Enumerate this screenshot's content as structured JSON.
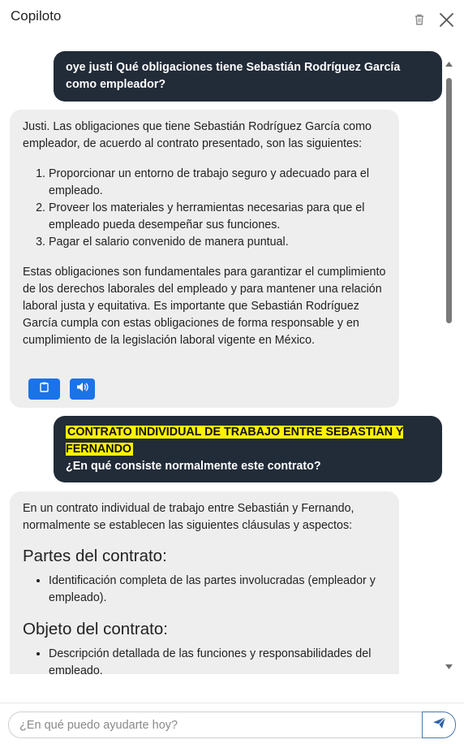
{
  "header": {
    "title": "Copiloto",
    "trash_icon": "trash-icon",
    "close_icon": "close-icon"
  },
  "messages": [
    {
      "role": "user",
      "text": "oye justi Qué obligaciones tiene Sebastián Rodríguez García como empleador?"
    },
    {
      "role": "assistant",
      "intro": "Justi. Las obligaciones que tiene Sebastián Rodríguez García como empleador, de acuerdo al contrato presentado, son las siguientes:",
      "items": [
        "Proporcionar un entorno de trabajo seguro y adecuado para el empleado.",
        "Proveer los materiales y herramientas necesarias para que el empleado pueda desempeñar sus funciones.",
        "Pagar el salario convenido de manera puntual."
      ],
      "outro": "Estas obligaciones son fundamentales para garantizar el cumplimiento de los derechos laborales del empleado y para mantener una relación laboral justa y equitativa. Es importante que Sebastián Rodríguez García cumpla con estas obligaciones de forma responsable y en cumplimiento de la legislación laboral vigente en México.",
      "actions": [
        "clipboard-icon",
        "speaker-icon"
      ]
    },
    {
      "role": "user",
      "highlight": "CONTRATO INDIVIDUAL DE TRABAJO ENTRE SEBASTIÁN Y FERNANDO",
      "question": "¿En qué consiste normalmente este contrato?"
    },
    {
      "role": "assistant",
      "intro": "En un contrato individual de trabajo entre Sebastián y Fernando, normalmente se establecen las siguientes cláusulas y aspectos:",
      "sections": [
        {
          "heading": "Partes del contrato:",
          "items": [
            "Identificación completa de las partes involucradas (empleador y empleado)."
          ]
        },
        {
          "heading": "Objeto del contrato:",
          "items": [
            "Descripción detallada de las funciones y responsabilidades del empleado."
          ]
        }
      ]
    }
  ],
  "input": {
    "placeholder": "¿En qué puedo ayudarte hoy?",
    "value": ""
  },
  "send_icon": "send-icon",
  "colors": {
    "user_bubble": "#222b38",
    "assistant_bubble": "#eeeeee",
    "highlight": "#fff200",
    "accent": "#1a73e8"
  }
}
